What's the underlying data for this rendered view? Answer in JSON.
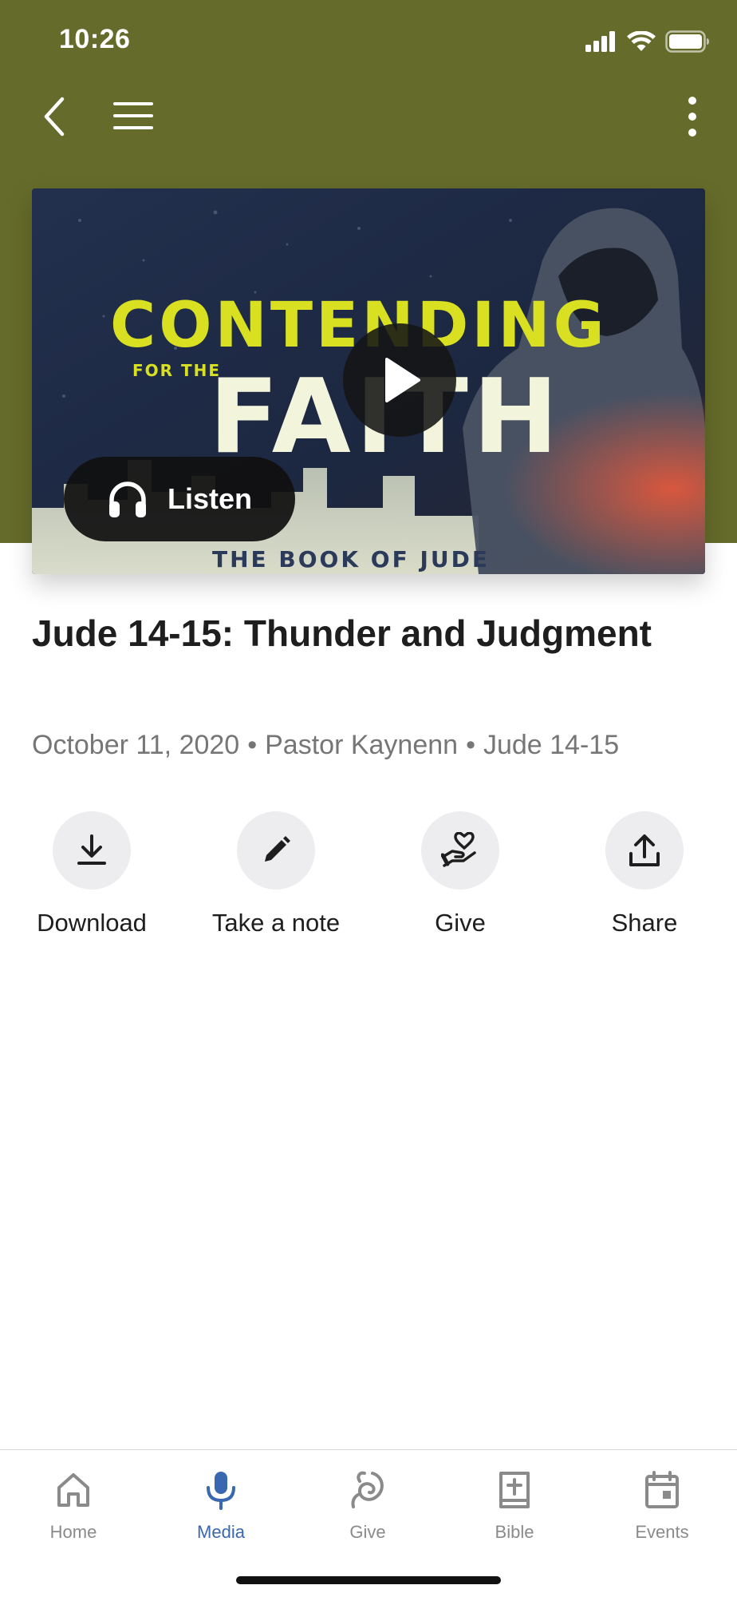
{
  "status_bar": {
    "time": "10:26",
    "icons": [
      "signal-icon",
      "wifi-icon",
      "battery-icon"
    ]
  },
  "nav": {
    "back_icon": "chevron-left-icon",
    "menu_icon": "hamburger-menu-icon",
    "more_icon": "more-vertical-icon"
  },
  "colors": {
    "header": "#656b2a",
    "accent": "#3a68b0",
    "muted_text": "#767676",
    "action_circle": "#ededef"
  },
  "hero": {
    "art_text_line1": "CONTENDING",
    "art_text_small": "FOR THE",
    "art_text_line2": "FAITH",
    "art_text_bottom": "THE BOOK OF JUDE",
    "play_icon": "play-icon",
    "listen_label": "Listen",
    "listen_icon": "headphones-icon"
  },
  "sermon": {
    "title": "Jude 14-15: Thunder and Judgment",
    "date": "October 11, 2020",
    "speaker": "Pastor Kaynenn",
    "passage": "Jude 14-15",
    "separator": "•"
  },
  "actions": [
    {
      "label": "Download",
      "icon": "download-icon"
    },
    {
      "label": "Take a note",
      "icon": "pencil-icon"
    },
    {
      "label": "Give",
      "icon": "give-hand-heart-icon"
    },
    {
      "label": "Share",
      "icon": "share-icon"
    }
  ],
  "tabs": [
    {
      "label": "Home",
      "icon": "home-icon",
      "active": false
    },
    {
      "label": "Media",
      "icon": "microphone-icon",
      "active": true
    },
    {
      "label": "Give",
      "icon": "give-icon",
      "active": false
    },
    {
      "label": "Bible",
      "icon": "bible-icon",
      "active": false
    },
    {
      "label": "Events",
      "icon": "calendar-icon",
      "active": false
    }
  ]
}
